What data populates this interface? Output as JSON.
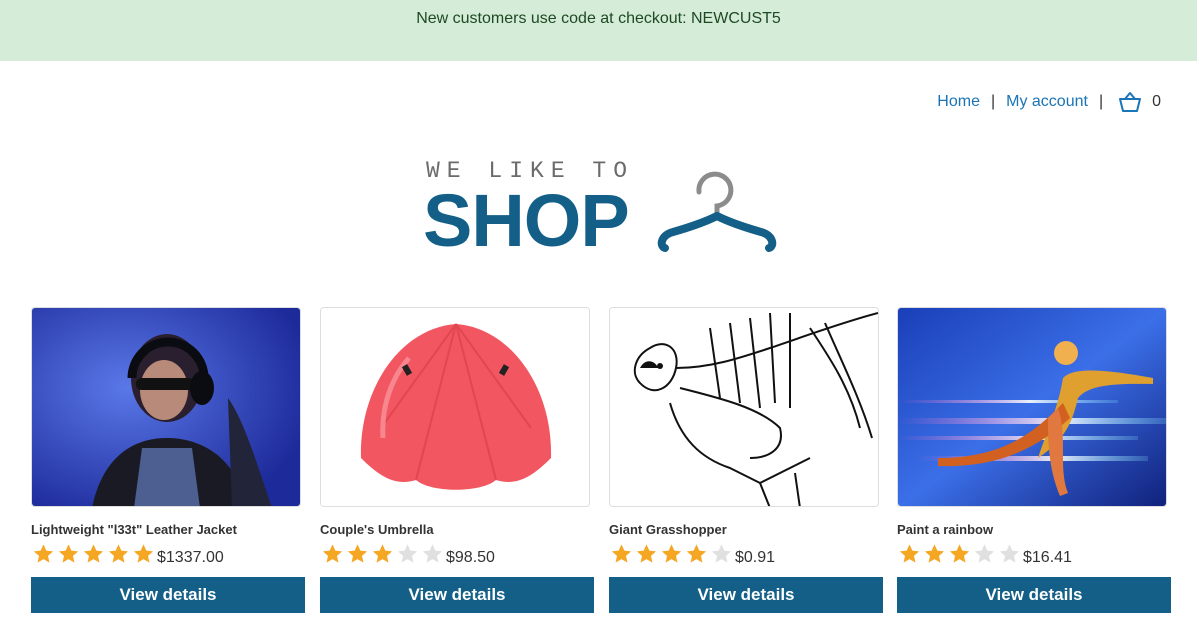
{
  "promo": {
    "text": "New customers use code at checkout: NEWCUST5"
  },
  "nav": {
    "home": "Home",
    "account": "My account",
    "cart_count": "0"
  },
  "logo": {
    "tagline": "WE LIKE TO",
    "word": "SHOP"
  },
  "products": [
    {
      "name": "Lightweight \"l33t\" Leather Jacket",
      "rating": 5,
      "price": "$1337.00",
      "button": "View details",
      "image": "woman-headphones-photo"
    },
    {
      "name": "Couple's Umbrella",
      "rating": 3,
      "price": "$98.50",
      "button": "View details",
      "image": "red-umbrella-photo"
    },
    {
      "name": "Giant Grasshopper",
      "rating": 4,
      "price": "$0.91",
      "button": "View details",
      "image": "grasshopper-sketch"
    },
    {
      "name": "Paint a rainbow",
      "rating": 3,
      "price": "$16.41",
      "button": "View details",
      "image": "rainbow-runner-art"
    }
  ],
  "colors": {
    "accent": "#135f87",
    "link": "#1a74b5",
    "star_on": "#f5a623",
    "star_off": "#e0e0e0",
    "promo_bg": "#d5ecd8"
  }
}
